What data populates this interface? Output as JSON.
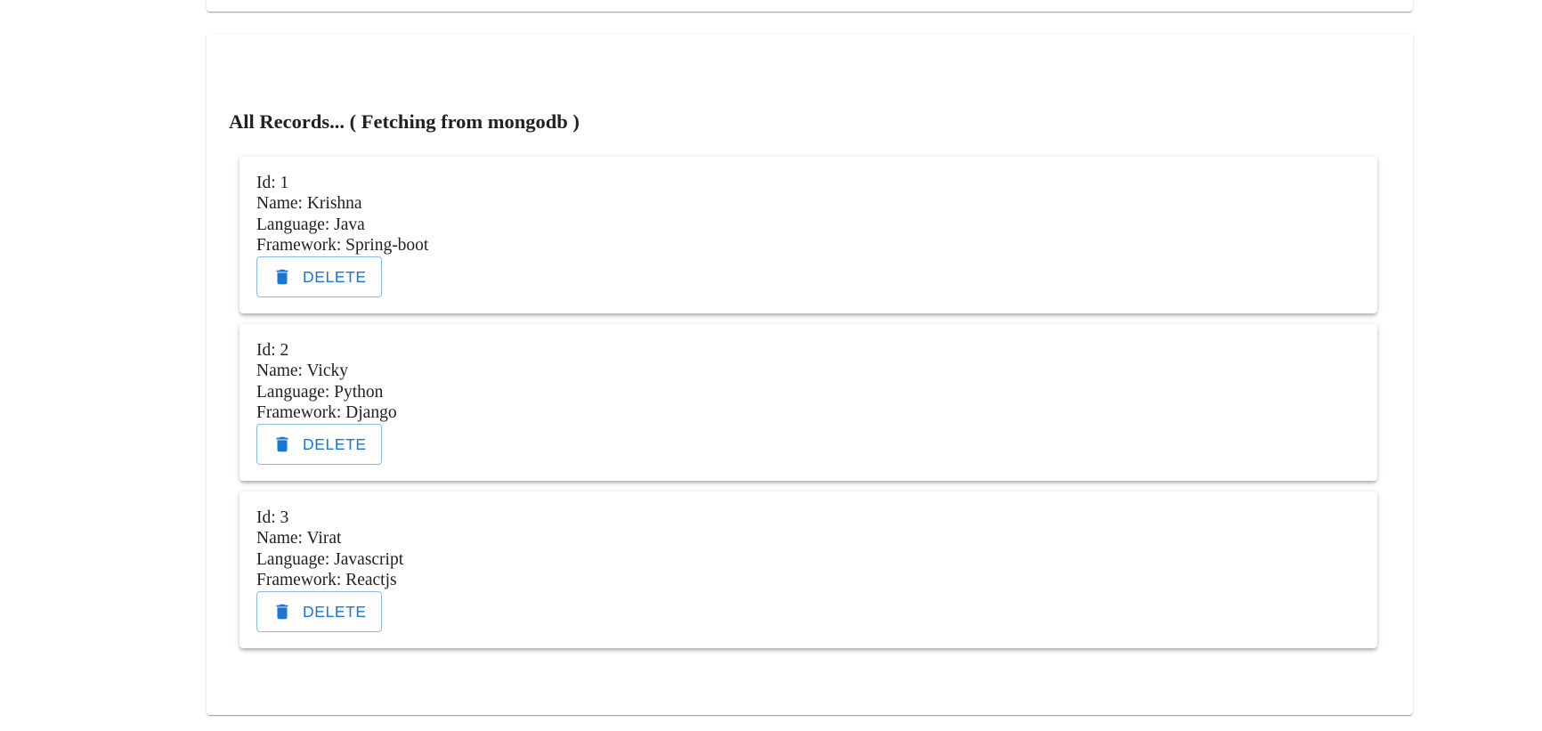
{
  "section": {
    "title": "All Records... ( Fetching from mongodb )"
  },
  "records": [
    {
      "id": "Id: 1",
      "name": "Name: Krishna",
      "language": "Language: Java",
      "framework": "Framework: Spring-boot",
      "delete_label": "DELETE"
    },
    {
      "id": "Id: 2",
      "name": "Name: Vicky",
      "language": "Language: Python",
      "framework": "Framework: Django",
      "delete_label": "DELETE"
    },
    {
      "id": "Id: 3",
      "name": "Name: Virat",
      "language": "Language: Javascript",
      "framework": "Framework: Reactjs",
      "delete_label": "DELETE"
    }
  ],
  "icons": {
    "delete": "trash-icon"
  },
  "colors": {
    "accent": "#1976d2",
    "text": "#212121",
    "button_border": "rgba(25,118,210,0.5)"
  }
}
